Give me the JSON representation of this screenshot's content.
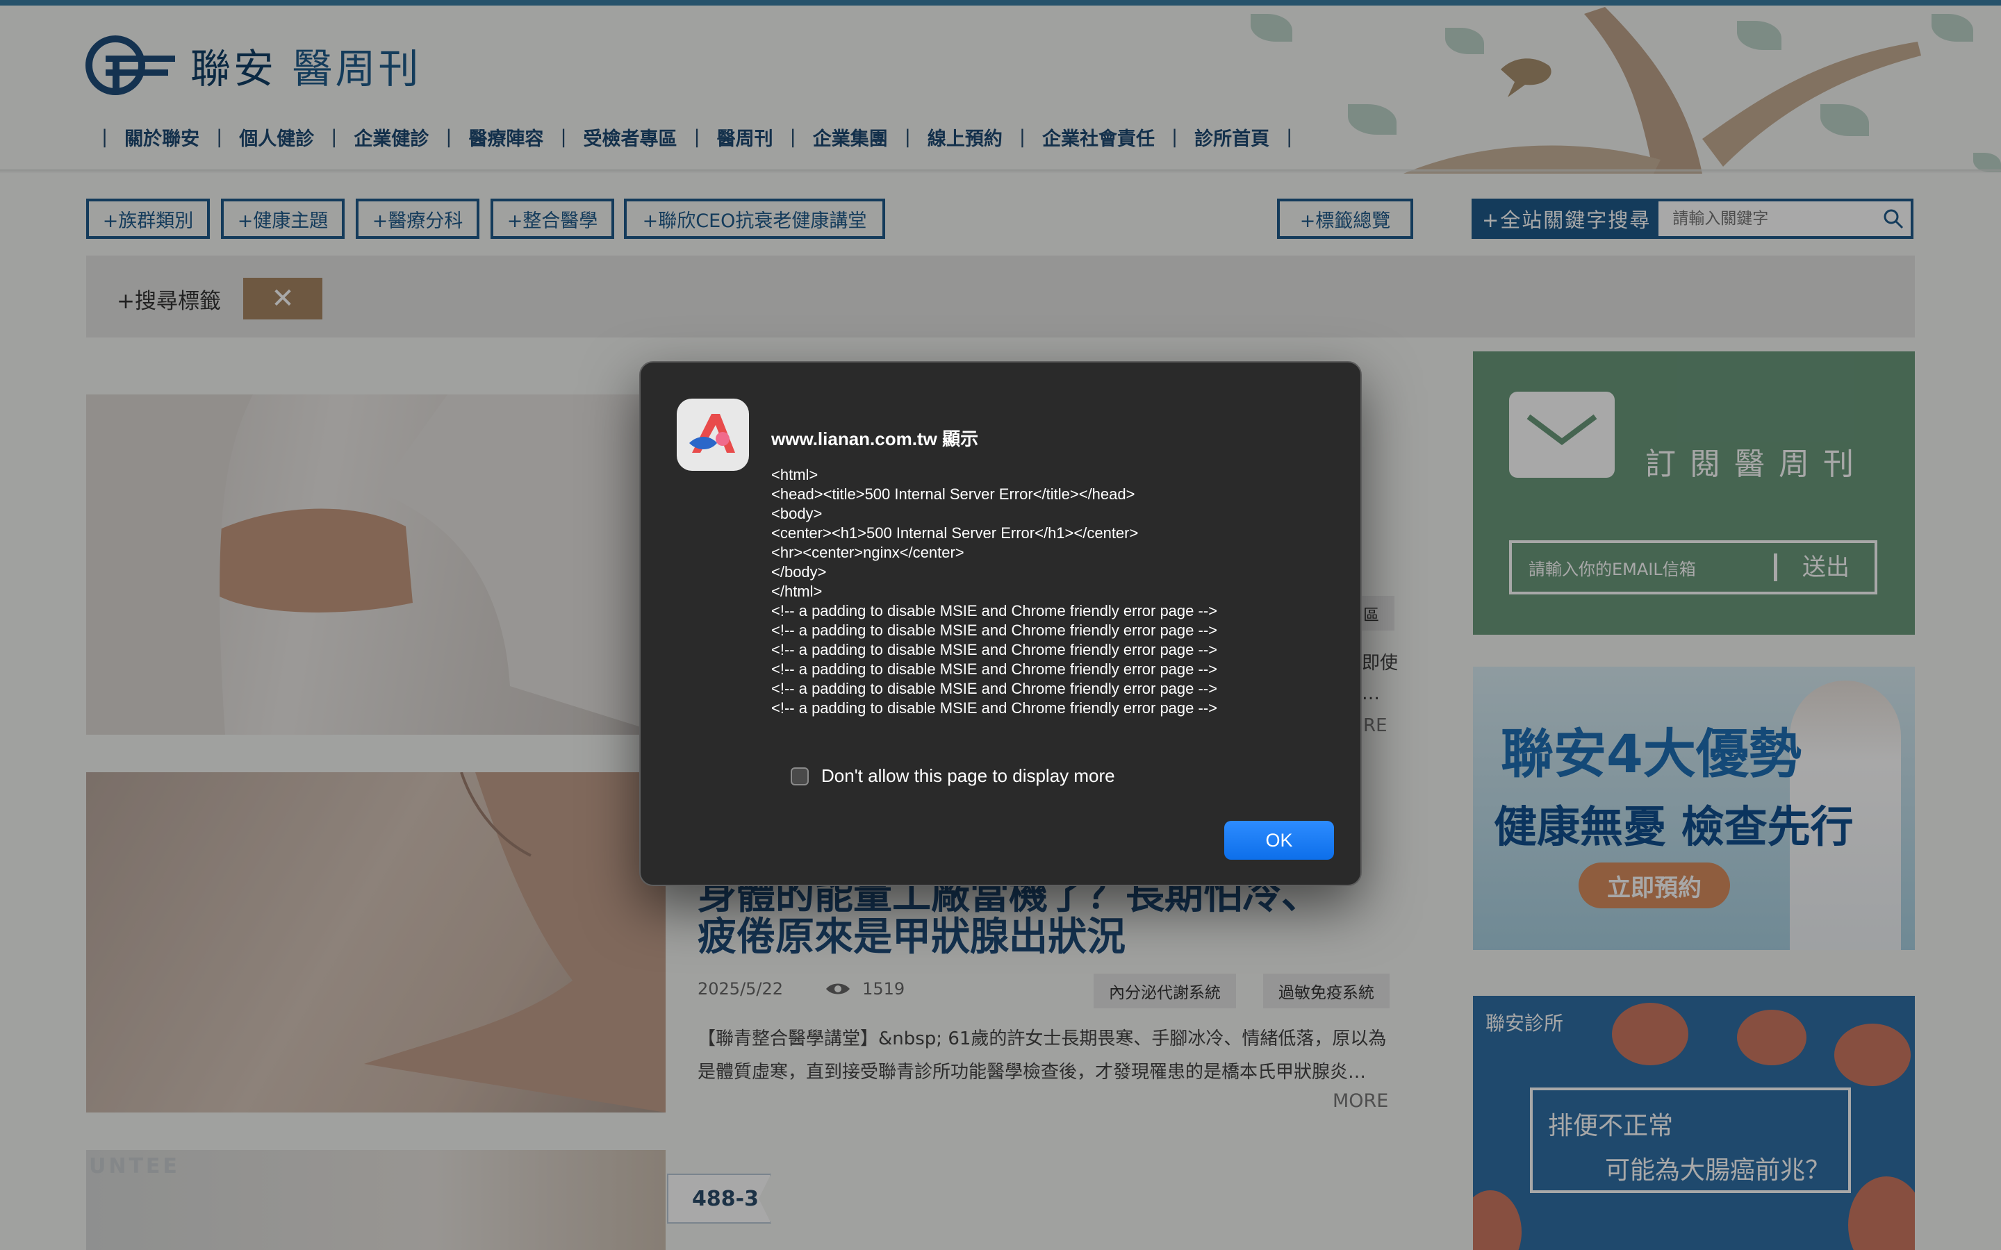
{
  "site": {
    "logo_text_brand": "聯安",
    "logo_text_pub": "醫周刊"
  },
  "nav": {
    "items": [
      "關於聯安",
      "個人健診",
      "企業健診",
      "醫療陣容",
      "受檢者專區",
      "醫周刊",
      "企業集團",
      "線上預約",
      "企業社會責任",
      "診所首頁"
    ]
  },
  "categories": {
    "btn1": "+族群類別",
    "btn2": "+健康主題",
    "btn3": "+醫療分科",
    "btn4": "+整合醫學",
    "btn5": "+聯欣CEO抗衰老健康講堂",
    "tags_overview": "+標籤總覽"
  },
  "search": {
    "label": "+全站關鍵字搜尋",
    "placeholder": "請輸入關鍵字"
  },
  "tagbar": {
    "title": "+搜尋標籤",
    "close": "✕"
  },
  "article1": {
    "partial_tag": "區",
    "partial_line1": "即使",
    "partial_line2": "…",
    "partial_more": "RE"
  },
  "article2": {
    "title_line1": "身體的能量工廠當機了？長期怕冷、",
    "title_line2": "疲倦原來是甲狀腺出狀況",
    "date": "2025/5/22",
    "views": "1519",
    "tag1": "內分泌代謝系統",
    "tag2": "過敏免疫系統",
    "summary": "【聯青整合醫學講堂】&nbsp; 61歲的許女士長期畏寒、手腳冰冷、情緒低落，原以為是體質虛寒，直到接受聯青診所功能醫學檢查後，才發現罹患的是橋本氏甲狀腺炎…",
    "more": "MORE"
  },
  "article3": {
    "badge": "488-3",
    "img_text": "UNTEE"
  },
  "sidebar": {
    "subscribe_title": "訂閱醫周刊",
    "email_placeholder": "請輸入你的EMAIL信箱",
    "send": "送出",
    "banner1_line1": "聯安4大優勢",
    "banner1_line2": "健康無憂 檢查先行",
    "banner1_button": "立即預約",
    "banner2_logo": "聯安診所",
    "banner2_line1": "排便不正常",
    "banner2_line2": "可能為大腸癌前兆？"
  },
  "dialog": {
    "title": "www.lianan.com.tw 顯示",
    "message": "<html>\n<head><title>500 Internal Server Error</title></head>\n<body>\n<center><h1>500 Internal Server Error</h1></center>\n<hr><center>nginx</center>\n</body>\n</html>\n<!-- a padding to disable MSIE and Chrome friendly error page -->\n<!-- a padding to disable MSIE and Chrome friendly error page -->\n<!-- a padding to disable MSIE and Chrome friendly error page -->\n<!-- a padding to disable MSIE and Chrome friendly error page -->\n<!-- a padding to disable MSIE and Chrome friendly error page -->\n<!-- a padding to disable MSIE and Chrome friendly error page -->",
    "checkbox_label": "Don't allow this page to display more",
    "ok": "OK"
  }
}
